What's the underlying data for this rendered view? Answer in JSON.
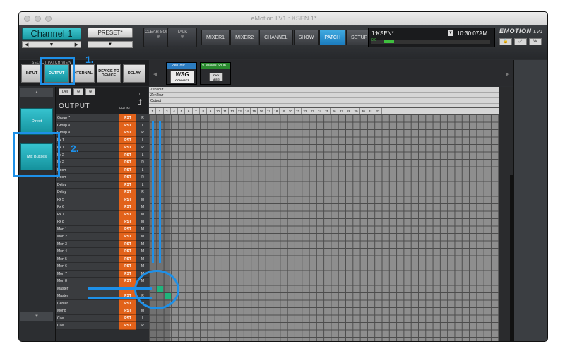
{
  "window": {
    "title": "eMotion LV1 : KSEN 1*"
  },
  "topbar": {
    "channel_name": "Channel 1",
    "preset_label": "PRESET*",
    "clear_solo": "CLEAR SOLO",
    "talk": "TALK",
    "tabs": [
      "MIXER1",
      "MIXER2",
      "CHANNEL",
      "SHOW",
      "PATCH",
      "SETUP"
    ],
    "active_tab": "PATCH",
    "session_name": "1:KSEN*",
    "time": "10:30:07AM",
    "meter_label": "0.0",
    "brand": "EMOTION",
    "brand_suffix": "LV1"
  },
  "patch_view": {
    "heading": "SELECT PATCH VIEW",
    "buttons": [
      "INPUT",
      "OUTPUT",
      "INTERNAL",
      "DEVICE TO DEVICE",
      "DELAY"
    ],
    "active": "OUTPUT"
  },
  "devices": [
    {
      "label": "1. ZenTour",
      "logo": "WSG",
      "logo_sub": "CONNECT"
    },
    {
      "label": "9. Waves Soun",
      "logo": "DiGi WSG"
    }
  ],
  "channel_types": [
    "Direct",
    "Mix Busses"
  ],
  "grid_header": {
    "title": "OUTPUT",
    "from": "FROM",
    "to": "TO",
    "del": "Del",
    "dest_rows": [
      "ZenTour",
      "ZenTour",
      "Output"
    ],
    "columns": [
      "1",
      "2",
      "3",
      "4",
      "5",
      "6",
      "7",
      "8",
      "9",
      "10",
      "11",
      "12",
      "13",
      "14",
      "15",
      "16",
      "17",
      "18",
      "19",
      "20",
      "21",
      "22",
      "23",
      "24",
      "25",
      "26",
      "27",
      "28",
      "29",
      "30",
      "31",
      "32"
    ]
  },
  "rows": [
    {
      "name": "Group 7",
      "src": "PST",
      "ch": "R"
    },
    {
      "name": "Group 8",
      "src": "PST",
      "ch": "L"
    },
    {
      "name": "Group 8",
      "src": "PST",
      "ch": "R"
    },
    {
      "name": "Fx 1",
      "src": "PST",
      "ch": "L"
    },
    {
      "name": "Fx 1",
      "src": "PST",
      "ch": "R"
    },
    {
      "name": "Fx 2",
      "src": "PST",
      "ch": "L"
    },
    {
      "name": "Fx 2",
      "src": "PST",
      "ch": "R"
    },
    {
      "name": "Room",
      "src": "PST",
      "ch": "L"
    },
    {
      "name": "Room",
      "src": "PST",
      "ch": "R"
    },
    {
      "name": "Delay",
      "src": "PST",
      "ch": "L"
    },
    {
      "name": "Delay",
      "src": "PST",
      "ch": "R"
    },
    {
      "name": "Fx 5",
      "src": "PST",
      "ch": "M"
    },
    {
      "name": "Fx 6",
      "src": "PST",
      "ch": "M"
    },
    {
      "name": "Fx 7",
      "src": "PST",
      "ch": "M"
    },
    {
      "name": "Fx 8",
      "src": "PST",
      "ch": "M"
    },
    {
      "name": "Mon 1",
      "src": "PST",
      "ch": "M"
    },
    {
      "name": "Mon 2",
      "src": "PST",
      "ch": "M"
    },
    {
      "name": "Mon 3",
      "src": "PST",
      "ch": "M"
    },
    {
      "name": "Mon 4",
      "src": "PST",
      "ch": "M"
    },
    {
      "name": "Mon 5",
      "src": "PST",
      "ch": "M"
    },
    {
      "name": "Mon 6",
      "src": "PST",
      "ch": "M"
    },
    {
      "name": "Mon 7",
      "src": "PST",
      "ch": "M"
    },
    {
      "name": "Mon 8",
      "src": "PST",
      "ch": "M"
    },
    {
      "name": "Master",
      "src": "PST",
      "ch": "L"
    },
    {
      "name": "Master",
      "src": "PST",
      "ch": "R"
    },
    {
      "name": "Center",
      "src": "PST",
      "ch": "M"
    },
    {
      "name": "Mono",
      "src": "PST",
      "ch": "M"
    },
    {
      "name": "Cue",
      "src": "PST",
      "ch": "L"
    },
    {
      "name": "Cue",
      "src": "PST",
      "ch": "R"
    }
  ],
  "patched": [
    {
      "row": 23,
      "col": 1
    },
    {
      "row": 24,
      "col": 2
    }
  ],
  "annotations": [
    "1.",
    "2."
  ],
  "colors": {
    "accent": "#1e90e8",
    "active_teal": "#1fa7b2",
    "pst": "#e2621a",
    "patch_cell": "#1fb57c"
  }
}
